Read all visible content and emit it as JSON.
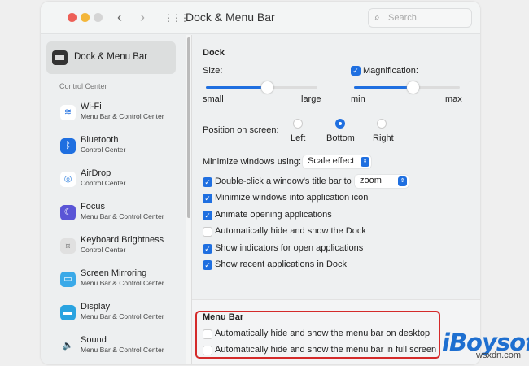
{
  "window": {
    "title": "Dock & Menu Bar",
    "search_placeholder": "Search",
    "back": "‹",
    "forward": "›",
    "grid": "⋮⋮⋮"
  },
  "colors": {
    "accent": "#1f6fe0",
    "highlight": "#d42a2a"
  },
  "sidebar": {
    "selected": "Dock & Menu Bar",
    "section": "Control Center",
    "items": [
      {
        "name": "Wi-Fi",
        "sub": "Menu Bar & Control Center",
        "icon": "wifi-icon",
        "glyph": "≋",
        "bg": "#ffffff",
        "fg": "#1f6fe0"
      },
      {
        "name": "Bluetooth",
        "sub": "Control Center",
        "icon": "bluetooth-icon",
        "glyph": "ᛒ",
        "bg": "#1f6fe0",
        "fg": "#fff"
      },
      {
        "name": "AirDrop",
        "sub": "Control Center",
        "icon": "airdrop-icon",
        "glyph": "◎",
        "bg": "#ffffff",
        "fg": "#3a86e0"
      },
      {
        "name": "Focus",
        "sub": "Menu Bar & Control Center",
        "icon": "moon-icon",
        "glyph": "☾",
        "bg": "#5a55d6",
        "fg": "#fff"
      },
      {
        "name": "Keyboard Brightness",
        "sub": "Control Center",
        "icon": "keyboard-brightness-icon",
        "glyph": "☼",
        "bg": "#e0e0e0",
        "fg": "#333"
      },
      {
        "name": "Screen Mirroring",
        "sub": "Menu Bar & Control Center",
        "icon": "screen-mirroring-icon",
        "glyph": "▭",
        "bg": "#3aa9e8",
        "fg": "#fff"
      },
      {
        "name": "Display",
        "sub": "Menu Bar & Control Center",
        "icon": "display-icon",
        "glyph": "▬",
        "bg": "#2aa3e0",
        "fg": "#fff"
      },
      {
        "name": "Sound",
        "sub": "Menu Bar & Control Center",
        "icon": "speaker-icon",
        "glyph": "🔈",
        "bg": "transparent",
        "fg": "#555"
      }
    ]
  },
  "dock": {
    "heading": "Dock",
    "size_label": "Size:",
    "size_min": "small",
    "size_max": "large",
    "size_value": 0.55,
    "magnification_label": "Magnification:",
    "magnification_checked": true,
    "mag_min": "min",
    "mag_max": "max",
    "mag_value": 0.55,
    "position_label": "Position on screen:",
    "positions": [
      "Left",
      "Bottom",
      "Right"
    ],
    "position_selected": "Bottom",
    "minimize_label": "Minimize windows using:",
    "minimize_value": "Scale effect",
    "double_click_label": "Double-click a window's title bar to",
    "double_click_value": "zoom",
    "options": [
      {
        "label": "Double-click a window's title bar to",
        "checked": true
      },
      {
        "label": "Minimize windows into application icon",
        "checked": true
      },
      {
        "label": "Animate opening applications",
        "checked": true
      },
      {
        "label": "Automatically hide and show the Dock",
        "checked": false
      },
      {
        "label": "Show indicators for open applications",
        "checked": true
      },
      {
        "label": "Show recent applications in Dock",
        "checked": true
      }
    ]
  },
  "menubar": {
    "heading": "Menu Bar",
    "options": [
      {
        "label": "Automatically hide and show the menu bar on desktop",
        "checked": false
      },
      {
        "label": "Automatically hide and show the menu bar in full screen",
        "checked": false
      }
    ]
  },
  "watermark": {
    "brand": "iBoysoft",
    "site": "wsxdn.com"
  }
}
